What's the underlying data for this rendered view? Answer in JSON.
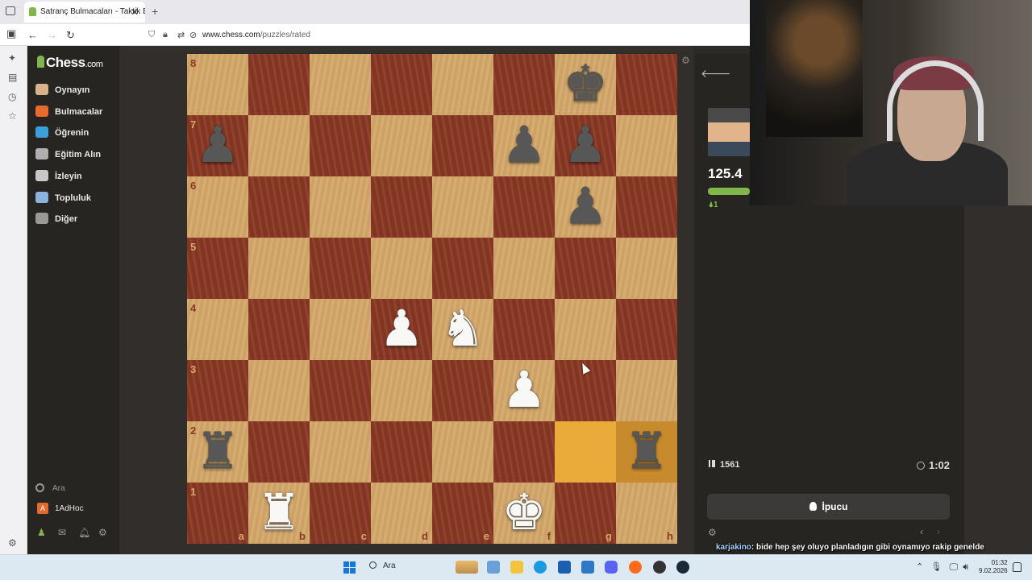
{
  "browser": {
    "tab_title": "Satranç Bulmacaları - Taktik Bul",
    "url_domain": "www.chess.com",
    "url_path": "/puzzles/rated"
  },
  "sidebar": {
    "logo_text": "Chess",
    "logo_suffix": ".com",
    "items": [
      {
        "label": "Oynayın",
        "icon": "play-pawn-icon",
        "color": "#d9b28a"
      },
      {
        "label": "Bulmacalar",
        "icon": "puzzle-icon",
        "color": "#e86a2c"
      },
      {
        "label": "Öğrenin",
        "icon": "learn-icon",
        "color": "#3d9fd9"
      },
      {
        "label": "Eğitim Alın",
        "icon": "coach-icon",
        "color": "#b0b0b0"
      },
      {
        "label": "İzleyin",
        "icon": "watch-icon",
        "color": "#c8c8c8"
      },
      {
        "label": "Topluluk",
        "icon": "community-icon",
        "color": "#8bb3dd"
      },
      {
        "label": "Diğer",
        "icon": "more-icon",
        "color": "#9a9996"
      }
    ],
    "search_label": "Ara",
    "user_initial": "A",
    "username": "1AdHoc"
  },
  "board": {
    "ranks": [
      "8",
      "7",
      "6",
      "5",
      "4",
      "3",
      "2",
      "1"
    ],
    "files": [
      "a",
      "b",
      "c",
      "d",
      "e",
      "f",
      "g",
      "h"
    ],
    "highlight_squares": [
      "g2",
      "h2"
    ],
    "pieces": {
      "g8": "bK",
      "a7": "bP",
      "f7": "bP",
      "g7": "bP",
      "g6": "bP",
      "d4": "wP",
      "e4": "wN",
      "f3": "wP",
      "a2": "bR",
      "h2": "bR",
      "b1": "wR",
      "f1": "wK"
    },
    "glyphs": {
      "K": "♚",
      "Q": "♛",
      "R": "♜",
      "B": "♝",
      "N": "♞",
      "P": "♟"
    }
  },
  "panel": {
    "score": "125.4",
    "streak": "1",
    "rating": "1561",
    "timer": "1:02",
    "hint_label": "İpucu"
  },
  "chat": {
    "user": "karjakino",
    "message": ": bide hep şey oluyo planladıgın gibi oynamıyo rakip genelde"
  },
  "taskbar": {
    "search_label": "Ara",
    "time": "01:32",
    "date": "9.02.2026"
  }
}
